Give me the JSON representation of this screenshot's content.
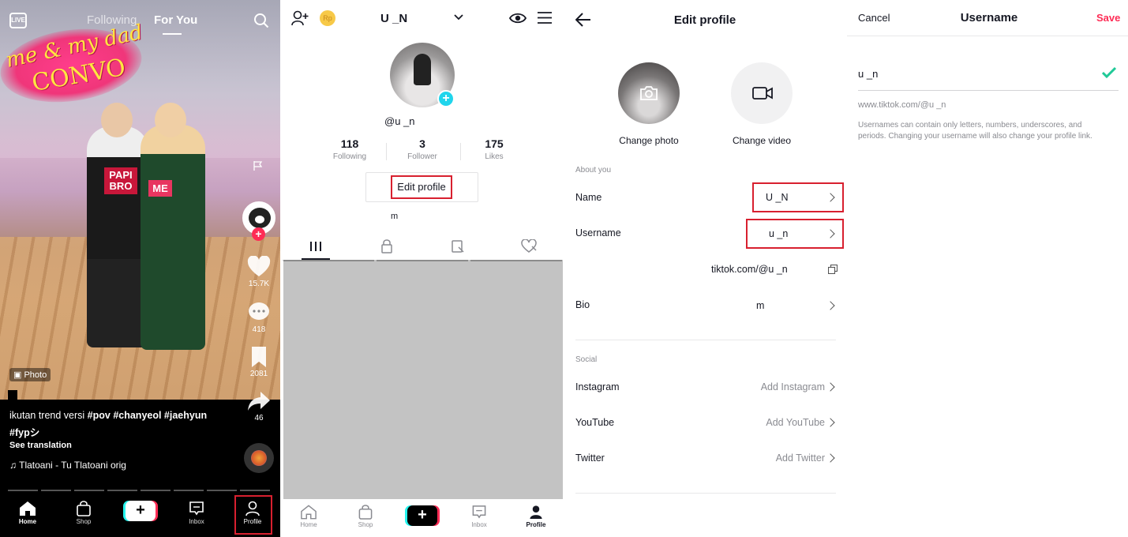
{
  "feed": {
    "top_nav": {
      "live_label": "LIVE",
      "following": "Following",
      "for_you": "For You"
    },
    "sticker_line1": "me & my dad",
    "sticker_line2": "CONVO",
    "shirt_left": "PAPI BRO",
    "shirt_right": "ME",
    "likes": "15.7K",
    "comments": "418",
    "bookmarks": "2081",
    "shares": "46",
    "photo_badge": "Photo",
    "caption_text": "ikutan trend versi ",
    "caption_tags": "#pov #chanyeol #jaehyun",
    "caption_tag2": "#fypシ",
    "see_translation": "See translation",
    "music": "♫ ​Tlatoani - Tu Tlatoani    orig",
    "nav": {
      "home": "Home",
      "shop": "Shop",
      "plus": "+",
      "inbox": "Inbox",
      "profile": "Profile"
    }
  },
  "profile": {
    "username": "U      _N",
    "coin": "Rp",
    "handle": "@u        _n",
    "stats": [
      {
        "num": "118",
        "label": "Following"
      },
      {
        "num": "3",
        "label": "Follower"
      },
      {
        "num": "175",
        "label": "Likes"
      }
    ],
    "edit_label": "Edit profile",
    "bio": "m",
    "nav": {
      "home": "Home",
      "shop": "Shop",
      "plus": "+",
      "inbox": "Inbox",
      "profile": "Profile"
    }
  },
  "edit_profile": {
    "title": "Edit profile",
    "change_photo": "Change photo",
    "change_video": "Change video",
    "about_header": "About you",
    "name_label": "Name",
    "name_value": "U      _N",
    "username_label": "Username",
    "username_value": "u      _n",
    "link_value": "tiktok.com/@u        _n",
    "bio_label": "Bio",
    "bio_value": "m",
    "social_header": "Social",
    "instagram_label": "Instagram",
    "instagram_value": "Add Instagram",
    "youtube_label": "YouTube",
    "youtube_value": "Add YouTube",
    "twitter_label": "Twitter",
    "twitter_value": "Add Twitter"
  },
  "username_edit": {
    "cancel": "Cancel",
    "title": "Username",
    "save": "Save",
    "input_value": "u       _n",
    "url": "www.tiktok.com/@u        _n",
    "help": "Usernames can contain only letters, numbers, underscores, and periods. Changing your username will also change your profile link.",
    "accent": "#fe2c55",
    "check_color": "#20c997"
  }
}
